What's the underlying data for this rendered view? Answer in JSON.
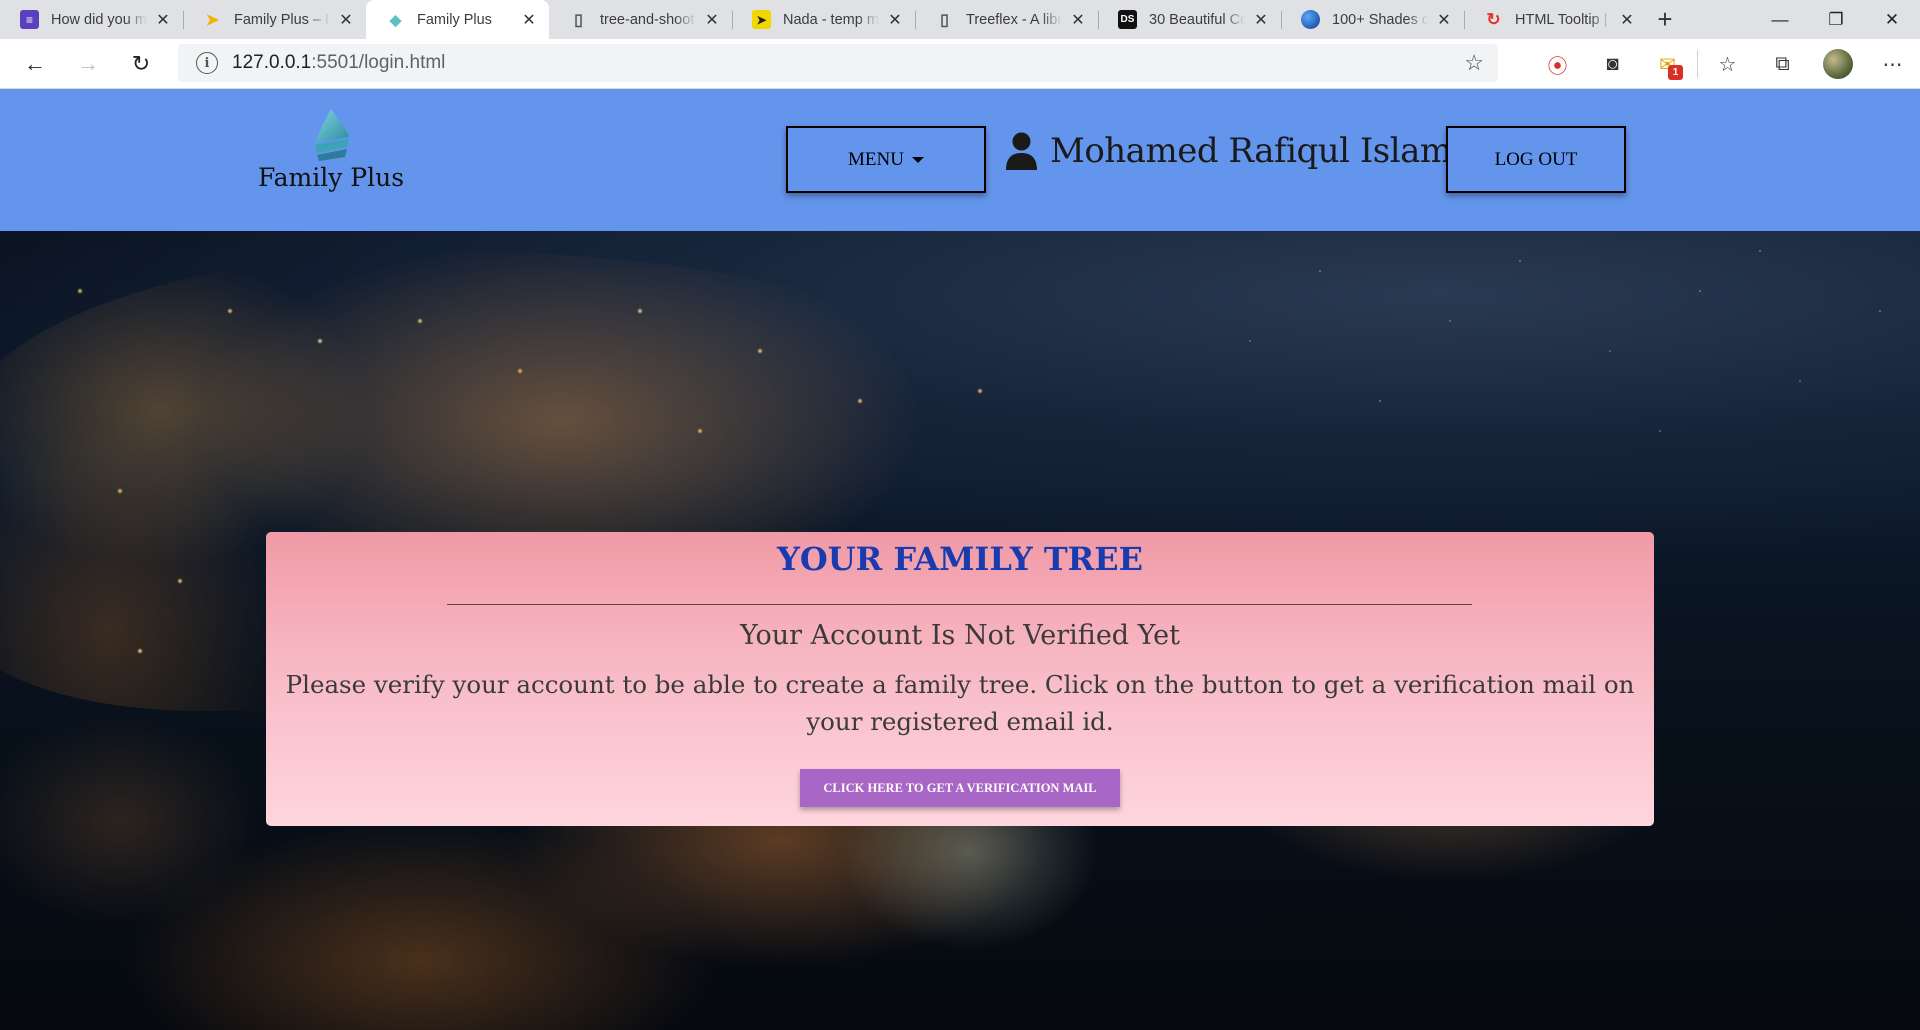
{
  "browser": {
    "tabs": [
      {
        "title": "How did you m",
        "icon": "forms-icon",
        "color": "#5b3fbf",
        "active": false
      },
      {
        "title": "Family Plus – Fi",
        "icon": "flutter-icon",
        "color": "#f2b300",
        "active": false
      },
      {
        "title": "Family Plus",
        "icon": "family-plus-favicon",
        "color": "#5bc0c8",
        "active": true
      },
      {
        "title": "tree-and-shoot",
        "icon": "page-icon",
        "color": "#555555",
        "active": false
      },
      {
        "title": "Nada - temp m",
        "icon": "paper-plane-icon",
        "color": "#f2d600",
        "active": false
      },
      {
        "title": "Treeflex - A libr",
        "icon": "page-icon",
        "color": "#555555",
        "active": false
      },
      {
        "title": "30 Beautiful Co",
        "icon": "ds-icon",
        "color": "#111111",
        "active": false
      },
      {
        "title": "100+ Shades o",
        "icon": "globe-icon",
        "color": "#1e6fd9",
        "active": false
      },
      {
        "title": "HTML Tooltip |",
        "icon": "c-icon",
        "color": "#e0352b",
        "active": false
      }
    ],
    "url_host": "127.0.0.1",
    "url_rest": ":5501/login.html",
    "badge_count": "1"
  },
  "navbar": {
    "brand_name": "Family Plus",
    "menu_label": "MENU",
    "user_name": "Mohamed Rafiqul Islam",
    "logout_label": "LOG OUT"
  },
  "card": {
    "title": "YOUR FAMILY TREE",
    "subtitle": "Your Account Is Not Verified Yet",
    "message": "Please verify your account to be able to create a family tree. Click on the button to get a verification mail on your registered email id.",
    "button_label": "CLICK HERE TO GET A VERIFICATION MAIL"
  },
  "colors": {
    "navbar": "#6495ed",
    "card_title": "#1a3bb0",
    "button": "#a866c6"
  }
}
